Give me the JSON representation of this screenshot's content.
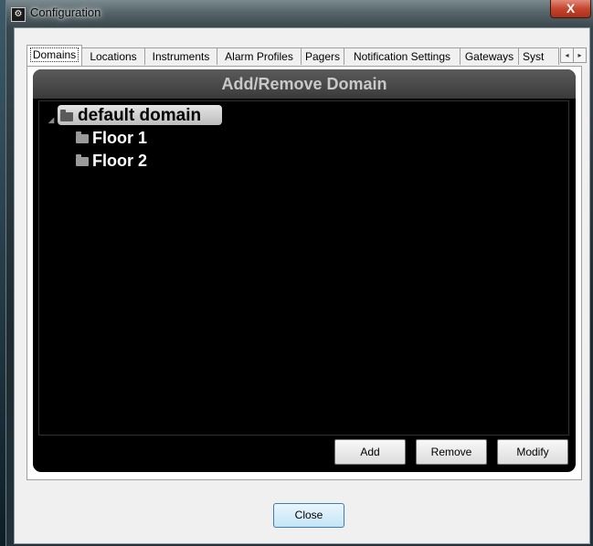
{
  "window": {
    "title": "Configuration",
    "title_icon": "gear-icon",
    "close_glyph": "X"
  },
  "tabs": [
    {
      "label": "Domains",
      "active": true
    },
    {
      "label": "Locations",
      "active": false
    },
    {
      "label": "Instruments",
      "active": false
    },
    {
      "label": "Alarm Profiles",
      "active": false
    },
    {
      "label": "Pagers",
      "active": false
    },
    {
      "label": "Notification Settings",
      "active": false
    },
    {
      "label": "Gateways",
      "active": false
    },
    {
      "label": "Syst",
      "active": false
    }
  ],
  "tab_scroll": {
    "left_glyph": "◂",
    "right_glyph": "▸"
  },
  "panel": {
    "title": "Add/Remove Domain"
  },
  "tree": {
    "root": {
      "label": "default domain",
      "expanded": true,
      "selected": true,
      "expander_glyph": "◢"
    },
    "children": [
      {
        "label": "Floor 1"
      },
      {
        "label": "Floor 2"
      }
    ]
  },
  "actions": {
    "add": "Add",
    "remove": "Remove",
    "modify": "Modify"
  },
  "footer": {
    "close": "Close"
  },
  "colors": {
    "panel_bg": "#000000",
    "header_bg": "#4a4a4a",
    "header_text": "#c9c9c9",
    "selection": "#d0d0d0",
    "close_button_accent": "#3c7fb1"
  }
}
